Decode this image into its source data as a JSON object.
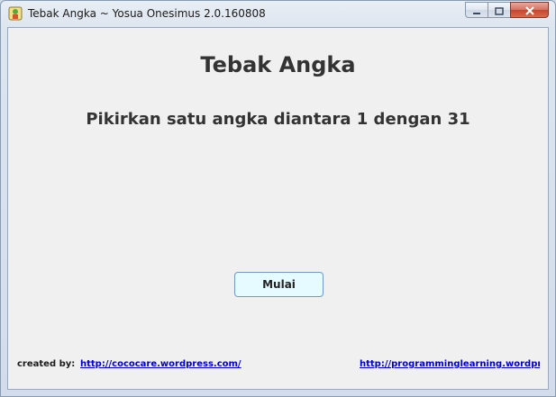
{
  "window": {
    "title": "Tebak Angka ~ Yosua Onesimus 2.0.160808",
    "app_icon": "game-app-icon",
    "controls": [
      "minimize-icon",
      "maximize-icon",
      "close-icon"
    ]
  },
  "main": {
    "heading": "Tebak Angka",
    "instruction": "Pikirkan satu angka diantara 1 dengan 31",
    "start_button_label": "Mulai"
  },
  "footer": {
    "created_by_label": "created by:",
    "link1_text": "http://cococare.wordpress.com/",
    "link2_text": "http://programminglearning.wordpress.com/"
  },
  "colors": {
    "link": "#0000cc",
    "text": "#333333",
    "button_bg": "#e6fbff",
    "close_button": "#c7452d"
  }
}
